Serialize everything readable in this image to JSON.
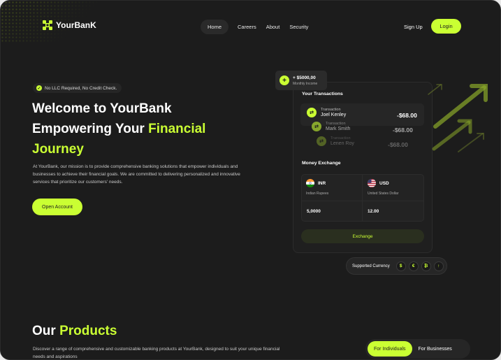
{
  "brand": {
    "name": "YourBanK"
  },
  "nav": {
    "items": [
      {
        "label": "Home",
        "active": true
      },
      {
        "label": "Careers"
      },
      {
        "label": "About"
      },
      {
        "label": "Security"
      }
    ],
    "signup": "Sign Up",
    "login": "Login"
  },
  "hero": {
    "badge": "No LLC Required, No Credit Check.",
    "title_line1": "Welcome to YourBank",
    "title_line2_prefix": "Empowering Your ",
    "title_line2_highlight": "Financial",
    "title_line3": "Journey",
    "description": "At YourBank, our mission is to provide comprehensive banking solutions that empower individuals and businesses to achieve their financial goals. We are committed to delivering personalized and innovative services that prioritize our customers' needs.",
    "cta": "Open Account"
  },
  "income": {
    "amount": "+ $5000,00",
    "label": "Monthly Income"
  },
  "transactions": {
    "title": "Your Transactions",
    "items": [
      {
        "label": "Transaction",
        "name": "Joel Kenley",
        "amount": "-$68.00"
      },
      {
        "label": "Transaction",
        "name": "Mark Smith",
        "amount": "-$68.00"
      },
      {
        "label": "Transaction",
        "name": "Lenen Roy",
        "amount": "-$68.00"
      }
    ]
  },
  "exchange": {
    "title": "Money Exchange",
    "from": {
      "code": "INR",
      "name": "Indian Rupees",
      "value": "5,0000"
    },
    "to": {
      "code": "USD",
      "name": "United States Dollar",
      "value": "12.00"
    },
    "button": "Exchange"
  },
  "supported": {
    "label": "Supported Currency",
    "symbols": [
      "$",
      "€",
      "₿",
      "↑"
    ]
  },
  "products": {
    "title_prefix": "Our ",
    "title_highlight": "Products",
    "description": "Discover a range of comprehensive and customizable banking products at YourBank, designed to suit your unique financial needs and aspirations",
    "tabs": [
      {
        "label": "For Individuals",
        "active": true
      },
      {
        "label": "For Businesses"
      }
    ]
  },
  "colors": {
    "accent": "#caff33",
    "background": "#1c1c1c"
  }
}
